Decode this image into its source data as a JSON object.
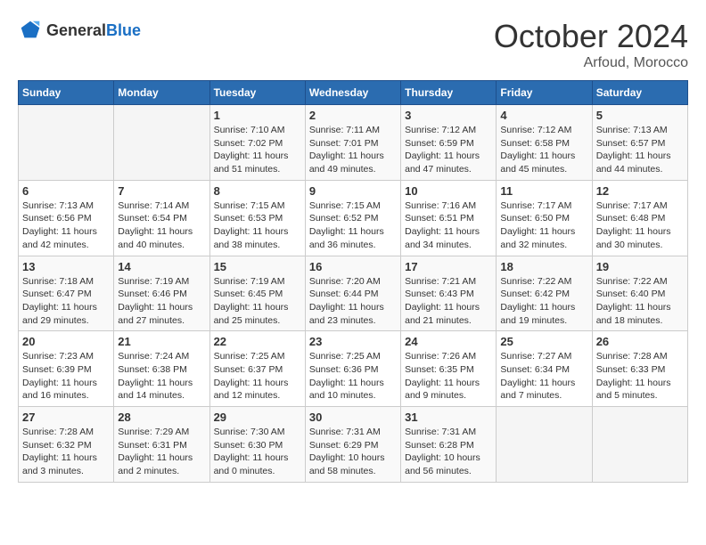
{
  "logo": {
    "general": "General",
    "blue": "Blue"
  },
  "title": {
    "month": "October 2024",
    "location": "Arfoud, Morocco"
  },
  "headers": [
    "Sunday",
    "Monday",
    "Tuesday",
    "Wednesday",
    "Thursday",
    "Friday",
    "Saturday"
  ],
  "weeks": [
    [
      {
        "day": "",
        "sunrise": "",
        "sunset": "",
        "daylight": ""
      },
      {
        "day": "",
        "sunrise": "",
        "sunset": "",
        "daylight": ""
      },
      {
        "day": "1",
        "sunrise": "Sunrise: 7:10 AM",
        "sunset": "Sunset: 7:02 PM",
        "daylight": "Daylight: 11 hours and 51 minutes."
      },
      {
        "day": "2",
        "sunrise": "Sunrise: 7:11 AM",
        "sunset": "Sunset: 7:01 PM",
        "daylight": "Daylight: 11 hours and 49 minutes."
      },
      {
        "day": "3",
        "sunrise": "Sunrise: 7:12 AM",
        "sunset": "Sunset: 6:59 PM",
        "daylight": "Daylight: 11 hours and 47 minutes."
      },
      {
        "day": "4",
        "sunrise": "Sunrise: 7:12 AM",
        "sunset": "Sunset: 6:58 PM",
        "daylight": "Daylight: 11 hours and 45 minutes."
      },
      {
        "day": "5",
        "sunrise": "Sunrise: 7:13 AM",
        "sunset": "Sunset: 6:57 PM",
        "daylight": "Daylight: 11 hours and 44 minutes."
      }
    ],
    [
      {
        "day": "6",
        "sunrise": "Sunrise: 7:13 AM",
        "sunset": "Sunset: 6:56 PM",
        "daylight": "Daylight: 11 hours and 42 minutes."
      },
      {
        "day": "7",
        "sunrise": "Sunrise: 7:14 AM",
        "sunset": "Sunset: 6:54 PM",
        "daylight": "Daylight: 11 hours and 40 minutes."
      },
      {
        "day": "8",
        "sunrise": "Sunrise: 7:15 AM",
        "sunset": "Sunset: 6:53 PM",
        "daylight": "Daylight: 11 hours and 38 minutes."
      },
      {
        "day": "9",
        "sunrise": "Sunrise: 7:15 AM",
        "sunset": "Sunset: 6:52 PM",
        "daylight": "Daylight: 11 hours and 36 minutes."
      },
      {
        "day": "10",
        "sunrise": "Sunrise: 7:16 AM",
        "sunset": "Sunset: 6:51 PM",
        "daylight": "Daylight: 11 hours and 34 minutes."
      },
      {
        "day": "11",
        "sunrise": "Sunrise: 7:17 AM",
        "sunset": "Sunset: 6:50 PM",
        "daylight": "Daylight: 11 hours and 32 minutes."
      },
      {
        "day": "12",
        "sunrise": "Sunrise: 7:17 AM",
        "sunset": "Sunset: 6:48 PM",
        "daylight": "Daylight: 11 hours and 30 minutes."
      }
    ],
    [
      {
        "day": "13",
        "sunrise": "Sunrise: 7:18 AM",
        "sunset": "Sunset: 6:47 PM",
        "daylight": "Daylight: 11 hours and 29 minutes."
      },
      {
        "day": "14",
        "sunrise": "Sunrise: 7:19 AM",
        "sunset": "Sunset: 6:46 PM",
        "daylight": "Daylight: 11 hours and 27 minutes."
      },
      {
        "day": "15",
        "sunrise": "Sunrise: 7:19 AM",
        "sunset": "Sunset: 6:45 PM",
        "daylight": "Daylight: 11 hours and 25 minutes."
      },
      {
        "day": "16",
        "sunrise": "Sunrise: 7:20 AM",
        "sunset": "Sunset: 6:44 PM",
        "daylight": "Daylight: 11 hours and 23 minutes."
      },
      {
        "day": "17",
        "sunrise": "Sunrise: 7:21 AM",
        "sunset": "Sunset: 6:43 PM",
        "daylight": "Daylight: 11 hours and 21 minutes."
      },
      {
        "day": "18",
        "sunrise": "Sunrise: 7:22 AM",
        "sunset": "Sunset: 6:42 PM",
        "daylight": "Daylight: 11 hours and 19 minutes."
      },
      {
        "day": "19",
        "sunrise": "Sunrise: 7:22 AM",
        "sunset": "Sunset: 6:40 PM",
        "daylight": "Daylight: 11 hours and 18 minutes."
      }
    ],
    [
      {
        "day": "20",
        "sunrise": "Sunrise: 7:23 AM",
        "sunset": "Sunset: 6:39 PM",
        "daylight": "Daylight: 11 hours and 16 minutes."
      },
      {
        "day": "21",
        "sunrise": "Sunrise: 7:24 AM",
        "sunset": "Sunset: 6:38 PM",
        "daylight": "Daylight: 11 hours and 14 minutes."
      },
      {
        "day": "22",
        "sunrise": "Sunrise: 7:25 AM",
        "sunset": "Sunset: 6:37 PM",
        "daylight": "Daylight: 11 hours and 12 minutes."
      },
      {
        "day": "23",
        "sunrise": "Sunrise: 7:25 AM",
        "sunset": "Sunset: 6:36 PM",
        "daylight": "Daylight: 11 hours and 10 minutes."
      },
      {
        "day": "24",
        "sunrise": "Sunrise: 7:26 AM",
        "sunset": "Sunset: 6:35 PM",
        "daylight": "Daylight: 11 hours and 9 minutes."
      },
      {
        "day": "25",
        "sunrise": "Sunrise: 7:27 AM",
        "sunset": "Sunset: 6:34 PM",
        "daylight": "Daylight: 11 hours and 7 minutes."
      },
      {
        "day": "26",
        "sunrise": "Sunrise: 7:28 AM",
        "sunset": "Sunset: 6:33 PM",
        "daylight": "Daylight: 11 hours and 5 minutes."
      }
    ],
    [
      {
        "day": "27",
        "sunrise": "Sunrise: 7:28 AM",
        "sunset": "Sunset: 6:32 PM",
        "daylight": "Daylight: 11 hours and 3 minutes."
      },
      {
        "day": "28",
        "sunrise": "Sunrise: 7:29 AM",
        "sunset": "Sunset: 6:31 PM",
        "daylight": "Daylight: 11 hours and 2 minutes."
      },
      {
        "day": "29",
        "sunrise": "Sunrise: 7:30 AM",
        "sunset": "Sunset: 6:30 PM",
        "daylight": "Daylight: 11 hours and 0 minutes."
      },
      {
        "day": "30",
        "sunrise": "Sunrise: 7:31 AM",
        "sunset": "Sunset: 6:29 PM",
        "daylight": "Daylight: 10 hours and 58 minutes."
      },
      {
        "day": "31",
        "sunrise": "Sunrise: 7:31 AM",
        "sunset": "Sunset: 6:28 PM",
        "daylight": "Daylight: 10 hours and 56 minutes."
      },
      {
        "day": "",
        "sunrise": "",
        "sunset": "",
        "daylight": ""
      },
      {
        "day": "",
        "sunrise": "",
        "sunset": "",
        "daylight": ""
      }
    ]
  ]
}
